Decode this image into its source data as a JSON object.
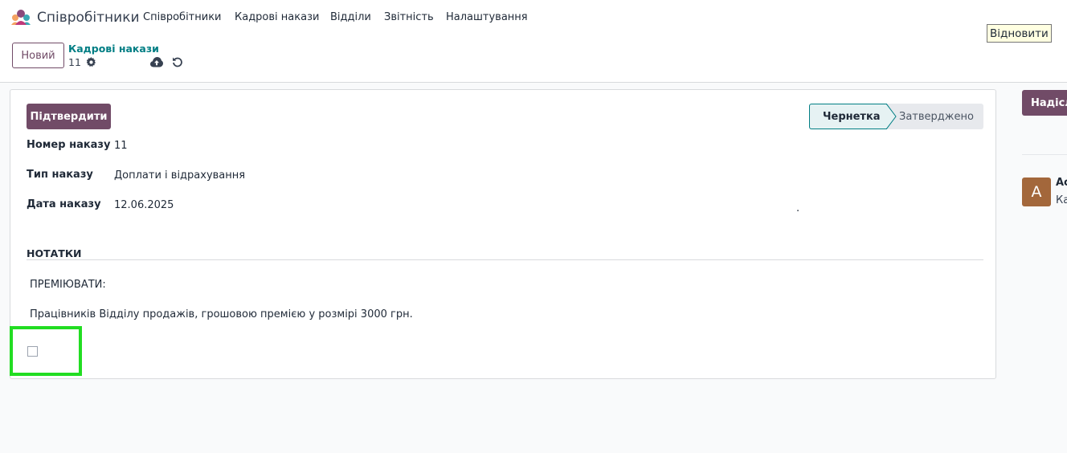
{
  "navbar": {
    "app_name": "Співробітники",
    "menu": [
      "Співробітники",
      "Кадрові накази",
      "Відділи",
      "Звітність",
      "Налаштування"
    ]
  },
  "control_panel": {
    "new_label": "Новий",
    "breadcrumb_parent": "Кадрові накази",
    "breadcrumb_current": "11",
    "icons": [
      "gear-icon",
      "cloud-upload-icon",
      "undo-icon"
    ]
  },
  "tooltip": "Відновити",
  "form": {
    "confirm_label": "Підтвердити",
    "stages": {
      "active": "Чернетка",
      "next": "Затверджено"
    },
    "fields": [
      {
        "label": "Номер наказу",
        "value": "11"
      },
      {
        "label": "Тип наказу",
        "value": "Доплати і відрахування"
      },
      {
        "label": "Дата наказу",
        "value": "12.06.2025"
      }
    ],
    "stray_dot": ".",
    "notes_title": "НОТАТКИ",
    "notes": [
      "ПРЕМІЮВАТИ:",
      "Працівників Відділу продажів, грошовою премією у розмірі 3000 грн."
    ]
  },
  "chatter": {
    "send_label": "Надісл",
    "avatar_letter": "A",
    "author": "Ac",
    "author_sub": "Ка"
  },
  "colors": {
    "brand": "#714b67",
    "accent": "#017e84",
    "highlight": "#22dd22",
    "avatar": "#a3673b"
  }
}
